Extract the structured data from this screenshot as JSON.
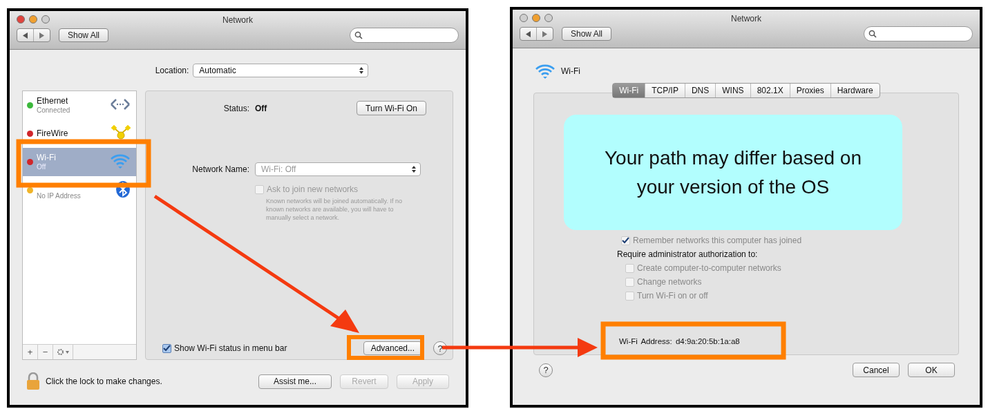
{
  "prefs_window": {
    "title": "Network",
    "show_all": "Show All",
    "location": {
      "label": "Location:",
      "value": "Automatic"
    },
    "services": [
      {
        "kind": "ethernet",
        "name": "Ethernet",
        "status": "Connected",
        "color": "#3cb83c",
        "selected": false
      },
      {
        "kind": "firewire",
        "name": "FireWire",
        "color": "#d0262b",
        "selected": false
      },
      {
        "kind": "wifi",
        "name": "Wi-Fi",
        "status": "Off",
        "color": "#d0262b",
        "selected": true
      },
      {
        "kind": "bluetooth",
        "status": "No IP Address",
        "color": "#f0b429",
        "selected": false
      }
    ],
    "list_tools": [
      "+",
      "−"
    ],
    "status": {
      "label": "Status:",
      "value": "Off"
    },
    "turn_button": "Turn Wi-Fi On",
    "network_name": {
      "label": "Network Name:",
      "value": "Wi-Fi: Off"
    },
    "ask_join": {
      "label": "Ask to join new networks",
      "checked": false,
      "disabled": true
    },
    "ask_join_note": "Known networks will be joined automatically. If no known networks are available, you will have to manually select a network.",
    "show_status": {
      "label": "Show Wi-Fi status in menu bar",
      "checked": true
    },
    "advanced_button": "Advanced...",
    "help": "?",
    "lock_text": "Click the lock to make changes.",
    "buttons": [
      {
        "label": "Assist me...",
        "disabled": false
      },
      {
        "label": "Revert",
        "disabled": true
      },
      {
        "label": "Apply",
        "disabled": true
      }
    ]
  },
  "sheet_window": {
    "title": "Network",
    "show_all": "Show All",
    "service_name": "Wi-Fi",
    "tabs": [
      {
        "label": "Wi-Fi",
        "selected": true
      },
      {
        "label": "TCP/IP",
        "selected": false
      },
      {
        "label": "DNS",
        "selected": false
      },
      {
        "label": "WINS",
        "selected": false
      },
      {
        "label": "802.1X",
        "selected": false
      },
      {
        "label": "Proxies",
        "selected": false
      },
      {
        "label": "Hardware",
        "selected": false
      }
    ],
    "remember": {
      "label": "Remember networks this computer has joined",
      "checked": true,
      "disabled": true
    },
    "require_label": "Require administrator authorization to:",
    "options": [
      {
        "label": "Create computer-to-computer networks",
        "checked": false
      },
      {
        "label": "Change networks",
        "checked": false
      },
      {
        "label": "Turn Wi-Fi on or off",
        "checked": false
      }
    ],
    "address": {
      "label": "Wi-Fi Address:",
      "value": "d4:9a:20:5b:1a:a8"
    },
    "help": "?",
    "buttons": [
      {
        "label": "Cancel",
        "default": false
      },
      {
        "label": "OK",
        "default": false
      }
    ]
  },
  "callout": {
    "text": "Your path may differ based on your version of the OS"
  }
}
